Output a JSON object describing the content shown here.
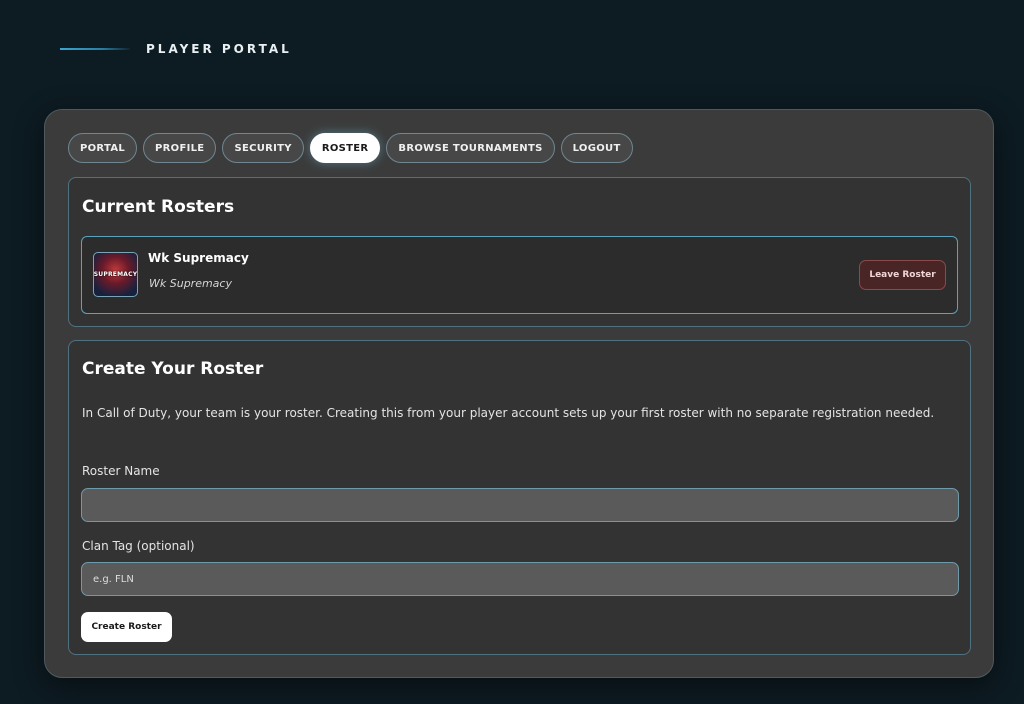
{
  "header": {
    "title": "PLAYER PORTAL"
  },
  "tabs": [
    {
      "label": "PORTAL"
    },
    {
      "label": "PROFILE"
    },
    {
      "label": "SECURITY"
    },
    {
      "label": "ROSTER",
      "active": true
    },
    {
      "label": "BROWSE TOURNAMENTS"
    },
    {
      "label": "LOGOUT"
    }
  ],
  "current_rosters": {
    "heading": "Current Rosters",
    "items": [
      {
        "name": "Wk Supremacy",
        "tag": "Wk Supremacy",
        "logo_text": "SUPREMACY",
        "leave_label": "Leave Roster"
      }
    ]
  },
  "create_roster": {
    "heading": "Create Your Roster",
    "description": "In Call of Duty, your team is your roster. Creating this from your player account sets up your first roster with no separate registration needed.",
    "name_label": "Roster Name",
    "name_value": "",
    "name_placeholder": "",
    "tag_label": "Clan Tag (optional)",
    "tag_value": "",
    "tag_placeholder": "e.g. FLN",
    "submit_label": "Create Roster"
  },
  "colors": {
    "background": "#0d1b22",
    "panel": "#3b3b3b",
    "card": "#333333",
    "accent": "#5da2bb",
    "danger_bg": "#4a2526"
  }
}
